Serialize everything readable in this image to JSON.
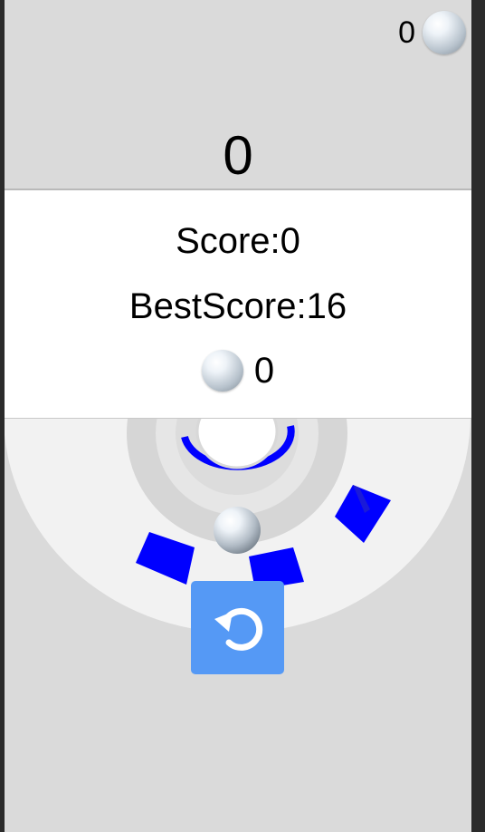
{
  "hud": {
    "coin_count": "0",
    "current_score": "0"
  },
  "result_panel": {
    "score_text": "Score:0",
    "best_score_text": "BestScore:16",
    "coins_earned": "0"
  },
  "icons": {
    "coin": "silver-ball-icon",
    "restart": "restart-arrow-icon"
  },
  "colors": {
    "background": "#dadada",
    "ring_outer": "#f2f2f2",
    "ring_inner": "#d0d0d0",
    "blade": "#0000ff",
    "panel": "#ffffff",
    "restart_button": "#5599f5"
  }
}
